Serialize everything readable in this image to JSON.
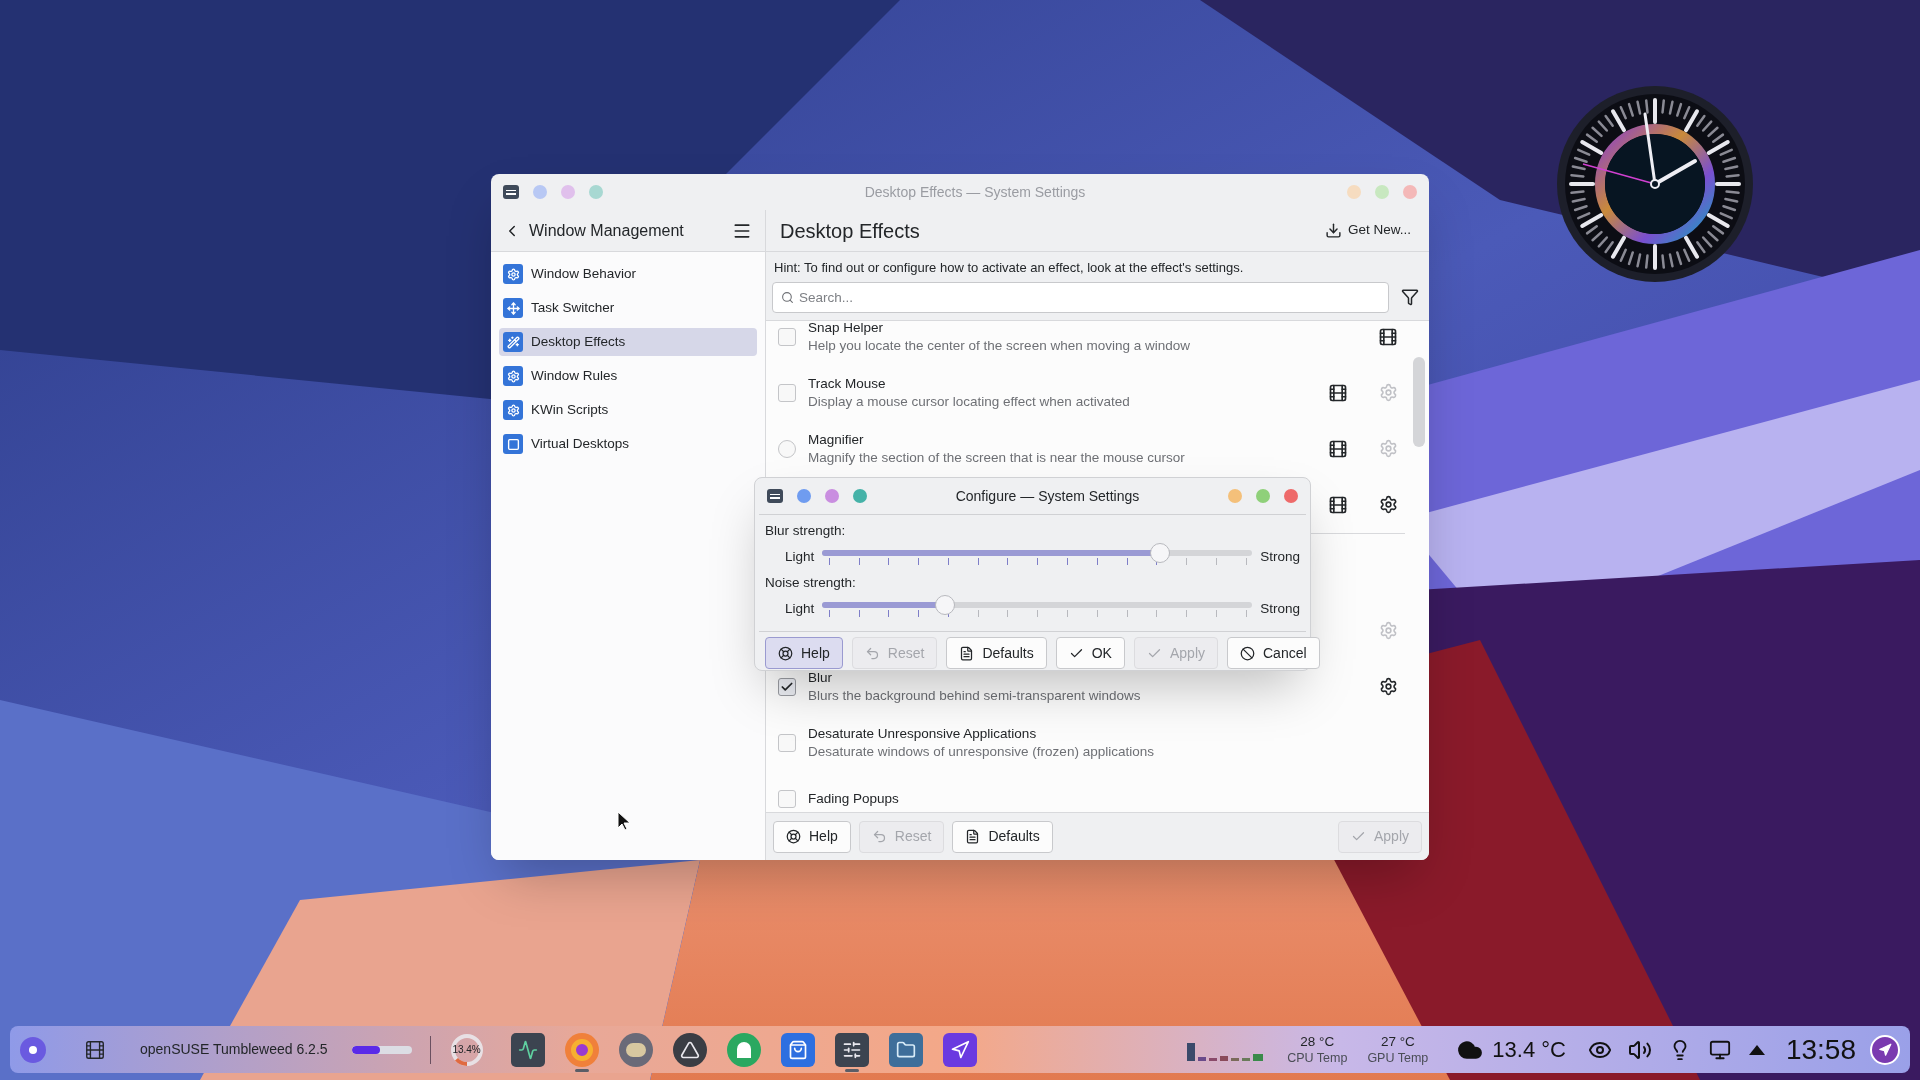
{
  "window": {
    "title": "Desktop Effects — System Settings",
    "active": false
  },
  "sidebar": {
    "title": "Window Management",
    "items": [
      {
        "label": "Window Behavior",
        "selected": false,
        "kind": "gear"
      },
      {
        "label": "Task Switcher",
        "selected": false,
        "kind": "switcher"
      },
      {
        "label": "Desktop Effects",
        "selected": true,
        "kind": "effects"
      },
      {
        "label": "Window Rules",
        "selected": false,
        "kind": "gear"
      },
      {
        "label": "KWin Scripts",
        "selected": false,
        "kind": "gear"
      },
      {
        "label": "Virtual Desktops",
        "selected": false,
        "kind": "desktops"
      }
    ]
  },
  "page": {
    "title": "Desktop Effects",
    "get_new": "Get New...",
    "hint": "Hint: To find out or configure how to activate an effect, look at the effect's settings.",
    "search": {
      "placeholder": "Search..."
    }
  },
  "effects": [
    {
      "name": "Snap Helper",
      "description": "Help you locate the center of the screen when moving a window",
      "kind": "checkbox",
      "checked": false,
      "video": true,
      "configurable": false
    },
    {
      "name": "Track Mouse",
      "description": "Display a mouse cursor locating effect when activated",
      "kind": "checkbox",
      "checked": false,
      "video": true,
      "configurable": true,
      "config_enabled": false
    },
    {
      "name": "Magnifier",
      "description": "Magnify the section of the screen that is near the mouse cursor",
      "kind": "radio",
      "checked": false,
      "video": true,
      "configurable": true,
      "config_enabled": false
    },
    {
      "kind": "covered",
      "video": true,
      "configurable": true,
      "config_enabled": true
    },
    {
      "kind": "covered",
      "video": false,
      "configurable": true,
      "config_enabled": false,
      "divider_before": true
    },
    {
      "name": "Blur",
      "description": "Blurs the background behind semi-transparent windows",
      "kind": "checkbox",
      "checked": true,
      "video": false,
      "configurable": true,
      "config_enabled": true
    },
    {
      "name": "Desaturate Unresponsive Applications",
      "description": "Desaturate windows of unresponsive (frozen) applications",
      "kind": "checkbox",
      "checked": false,
      "video": false,
      "configurable": false
    },
    {
      "name": "Fading Popups",
      "kind": "checkbox",
      "checked": false,
      "video": false,
      "configurable": false
    }
  ],
  "footer": {
    "left_buttons": [
      {
        "label": "Help",
        "kind": "help",
        "disabled": false
      },
      {
        "label": "Reset",
        "kind": "reset",
        "disabled": true
      },
      {
        "label": "Defaults",
        "kind": "defaults",
        "disabled": false
      }
    ],
    "right_buttons": [
      {
        "label": "Apply",
        "kind": "apply",
        "disabled": true
      }
    ]
  },
  "dialog": {
    "title": "Configure — System Settings",
    "active": true,
    "sliders": [
      {
        "label": "Blur strength:",
        "min_label": "Light",
        "max_label": "Strong",
        "level": 0.786
      },
      {
        "label": "Noise strength:",
        "min_label": "Light",
        "max_label": "Strong",
        "level": 0.286
      }
    ],
    "buttons": [
      {
        "label": "Help",
        "kind": "help",
        "disabled": false,
        "focused": true
      },
      {
        "label": "Reset",
        "kind": "reset",
        "disabled": true,
        "focused": false
      },
      {
        "label": "Defaults",
        "kind": "defaults",
        "disabled": false,
        "focused": false
      },
      {
        "label": "OK",
        "kind": "ok",
        "disabled": false,
        "focused": false
      },
      {
        "label": "Apply",
        "kind": "apply",
        "disabled": true,
        "focused": false
      },
      {
        "label": "Cancel",
        "kind": "cancel",
        "disabled": false,
        "focused": false
      }
    ]
  },
  "taskbar": {
    "os_label": "openSUSE Tumbleweed 6.2.5",
    "progress": {
      "level": 0.48
    },
    "cpu_gauge": {
      "label": "13.4%"
    },
    "apps": [
      {
        "kind": "monitor",
        "running": false
      },
      {
        "kind": "firefox",
        "running": true
      },
      {
        "kind": "gimp",
        "running": false
      },
      {
        "kind": "inkscape",
        "running": false
      },
      {
        "kind": "mastodon",
        "running": false
      },
      {
        "kind": "store",
        "running": false
      },
      {
        "kind": "settings",
        "running": true
      },
      {
        "kind": "files",
        "running": false
      },
      {
        "kind": "fapp",
        "running": false
      }
    ],
    "temps": [
      {
        "value": "28 °C",
        "label": "CPU Temp"
      },
      {
        "value": "27 °C",
        "label": "GPU Temp"
      }
    ],
    "weather": "13.4 °C",
    "clock": "13:58"
  }
}
